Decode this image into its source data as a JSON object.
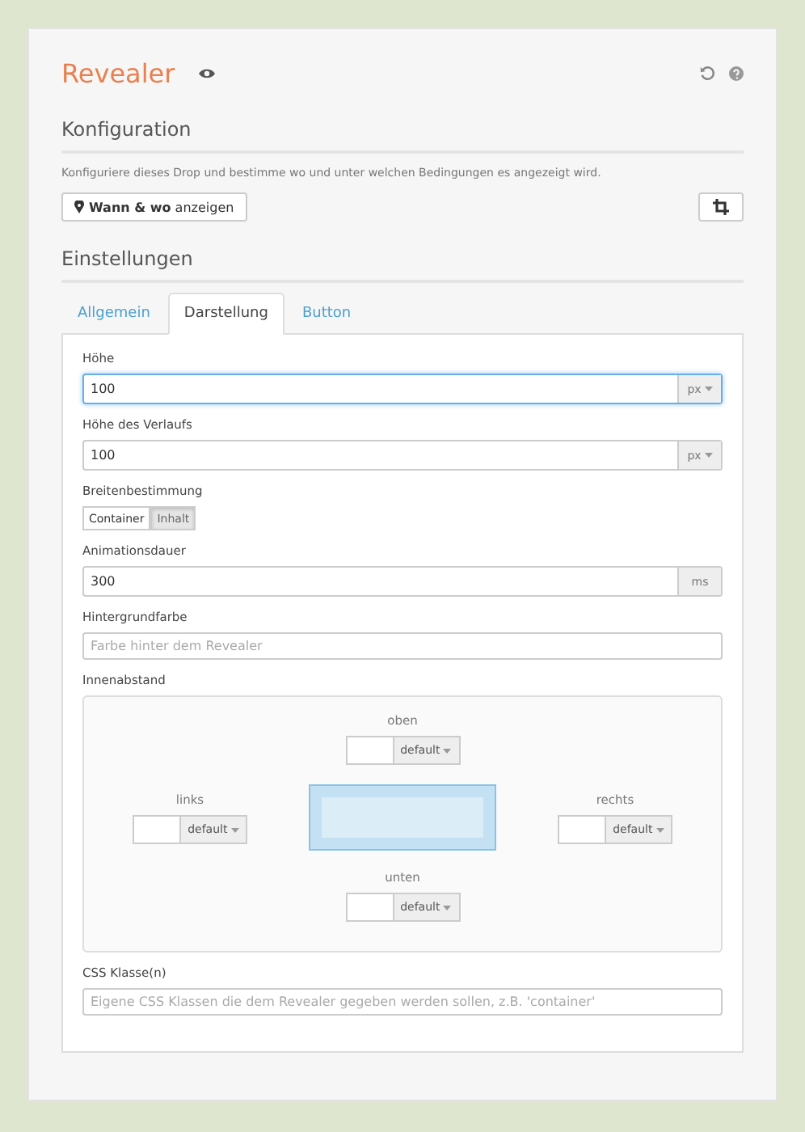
{
  "header": {
    "title": "Revealer"
  },
  "configuration": {
    "heading": "Konfiguration",
    "description": "Konfiguriere dieses Drop und bestimme wo und unter welchen Bedingungen es angezeigt wird.",
    "where_button": "**Wann & wo** anzeigen"
  },
  "settings": {
    "heading": "Einstellungen",
    "tabs": [
      {
        "label": "Allgemein",
        "selected": false
      },
      {
        "label": "Darstellung",
        "selected": true
      },
      {
        "label": "Button",
        "selected": false
      }
    ]
  },
  "fields": [
    {
      "kind": "unit_select",
      "label": "Höhe",
      "value": "100",
      "unit": "px",
      "focused": true
    },
    {
      "kind": "unit_select",
      "label": "Höhe des Verlaufs",
      "value": "100",
      "unit": "px",
      "focused": false
    },
    {
      "kind": "toggle",
      "label": "Breitenbestimmung",
      "options": [
        {
          "label": "Container",
          "selected": false
        },
        {
          "label": "Inhalt",
          "selected": true
        }
      ]
    },
    {
      "kind": "unit",
      "label": "Animationsdauer",
      "value": "300",
      "unit": "ms"
    },
    {
      "kind": "text",
      "label": "Hintergrundfarbe",
      "placeholder": "Farbe hinter dem Revealer"
    },
    {
      "kind": "padding",
      "label": "Innenabstand",
      "sides": [
        {
          "label": "oben",
          "unit": "default"
        },
        {
          "label": "links",
          "unit": "default"
        },
        {
          "label": "rechts",
          "unit": "default"
        },
        {
          "label": "unten",
          "unit": "default"
        }
      ]
    },
    {
      "kind": "text",
      "label": "CSS Klasse(n)",
      "placeholder": "Eigene CSS Klassen die dem Revealer gegeben werden sollen, z.B. 'container'"
    }
  ]
}
